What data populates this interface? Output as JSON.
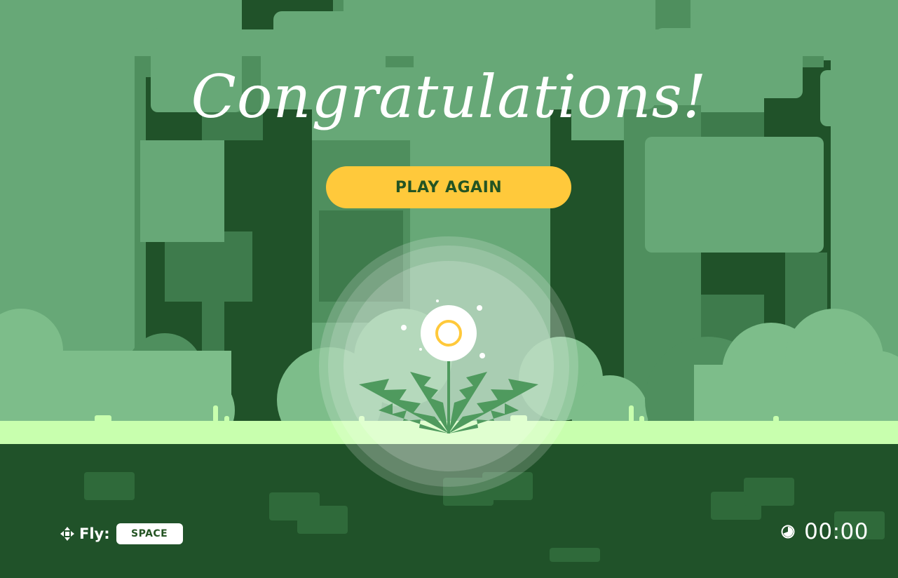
{
  "game": {
    "title": "Congratulations!",
    "play_again_label": "PLAY AGAIN"
  },
  "controls": {
    "action_label": "Fly:",
    "key_label": "SPACE",
    "move_icon": "move-arrows-icon"
  },
  "timer": {
    "icon": "clock-icon",
    "value": "00:00"
  },
  "colors": {
    "sky": "#67a877",
    "canopy_dark": "#205229",
    "ground_strip": "#c8ffae",
    "soil": "#205229",
    "button": "#ffc93b",
    "button_text": "#245423",
    "bush": "#7dbd8a"
  }
}
